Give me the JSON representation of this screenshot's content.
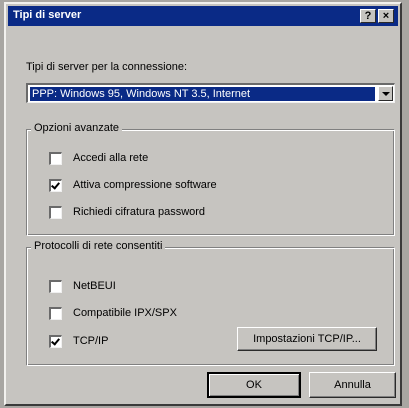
{
  "window": {
    "title": "Tipi di server",
    "help_button": "?",
    "close_button": "×"
  },
  "server_type": {
    "label": "Tipi di server per la connessione:",
    "selected_value": "PPP: Windows 95, Windows NT 3.5, Internet"
  },
  "advanced_options": {
    "group_label": "Opzioni avanzate",
    "items": [
      {
        "label": "Accedi alla rete",
        "checked": false
      },
      {
        "label": "Attiva compressione software",
        "checked": true
      },
      {
        "label": "Richiedi cifratura password",
        "checked": false
      }
    ]
  },
  "protocols": {
    "group_label": "Protocolli di rete consentiti",
    "items": [
      {
        "label": "NetBEUI",
        "checked": false
      },
      {
        "label": "Compatibile IPX/SPX",
        "checked": false
      },
      {
        "label": "TCP/IP",
        "checked": true
      }
    ],
    "tcp_settings_button": "Impostazioni TCP/IP..."
  },
  "buttons": {
    "ok": "OK",
    "cancel": "Annulla"
  },
  "colors": {
    "titlebar": "#0a2a86",
    "dialog_face": "#c6c4c0",
    "selection": "#0a2a86"
  }
}
